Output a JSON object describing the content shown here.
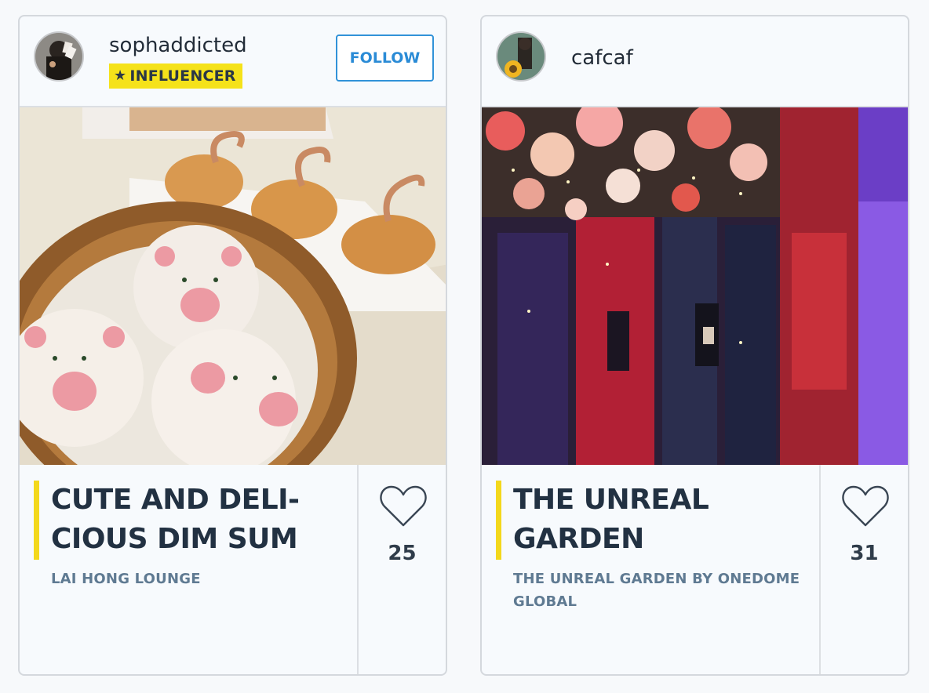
{
  "posts": [
    {
      "username": "sophaddicted",
      "badge": {
        "icon": "star-icon",
        "label": "INFLUENCER"
      },
      "follow_label": "FOLLOW",
      "photo": "dim sum: pig-shaped buns in bamboo steamer, swan pastries",
      "title": "CUTE AND DELI- CIOUS DIM SUM",
      "location": "LAI HONG LOUNGE",
      "likes": "25"
    },
    {
      "username": "cafcaf",
      "photo": "mirrored room with flowers, lights and red rock walls",
      "title": "THE UNREAL GARDEN",
      "location": "THE UNREAL GARDEN BY ONEDOME GLOBAL",
      "likes": "31"
    }
  ],
  "colors": {
    "accent": "#f3d81c",
    "follow": "#2a8bd6",
    "title": "#223142",
    "location": "#5f7a92",
    "badge": "#f5e21a"
  }
}
